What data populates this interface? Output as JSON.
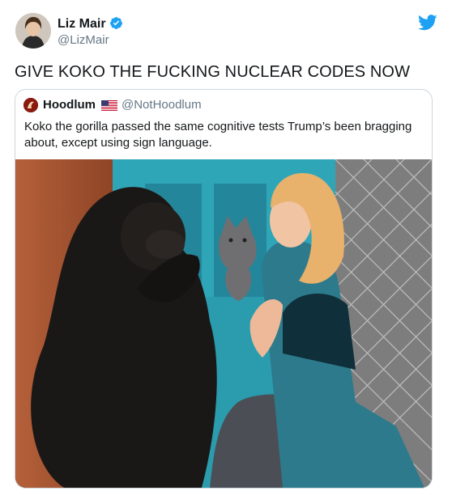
{
  "tweet": {
    "author_name": "Liz Mair",
    "author_handle": "@LizMair",
    "text": "GIVE KOKO THE FUCKING NUCLEAR CODES NOW"
  },
  "quoted_tweet": {
    "author_name": "Hoodlum",
    "author_handle": "@NotHoodlum",
    "text": "Koko the gorilla passed the same cognitive tests Trump’s been bragging about, except using sign language."
  },
  "colors": {
    "twitter_blue": "#1DA1F2",
    "text_primary": "#14171A",
    "text_secondary": "#657786",
    "border": "#CCD6DD"
  },
  "icons": {
    "verified": "verified-badge-icon",
    "logo": "twitter-bird-icon",
    "flag": "us-flag-icon"
  }
}
